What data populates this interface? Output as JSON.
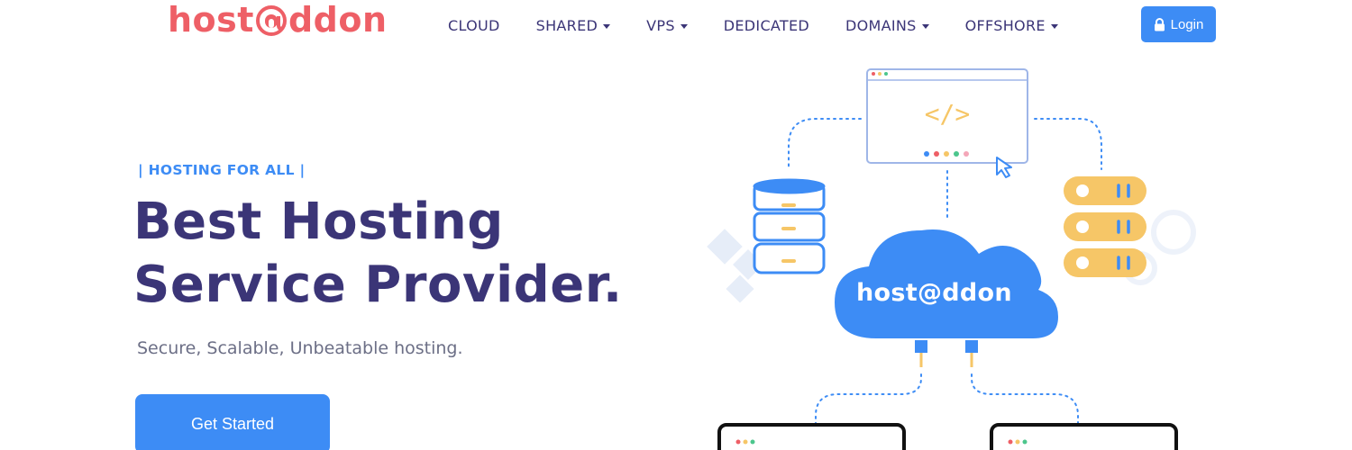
{
  "brand": {
    "name_before": "host",
    "name_after": "ddon",
    "color": "#ee5f66"
  },
  "nav": {
    "items": [
      {
        "label": "CLOUD",
        "dropdown": false
      },
      {
        "label": "SHARED",
        "dropdown": true
      },
      {
        "label": "VPS",
        "dropdown": true
      },
      {
        "label": "DEDICATED",
        "dropdown": false
      },
      {
        "label": "DOMAINS",
        "dropdown": true
      },
      {
        "label": "OFFSHORE",
        "dropdown": true
      }
    ],
    "login_label": "Login",
    "login_icon": "lock-icon"
  },
  "hero": {
    "eyebrow": "| HOSTING FOR ALL |",
    "headline_line1": "Best Hosting",
    "headline_line2": "Service Provider.",
    "subtext": "Secure, Scalable, Unbeatable hosting.",
    "cta_label": "Get Started"
  },
  "illustration": {
    "cloud_label": "host@ddon",
    "code_glyph": "</>",
    "accent_blue": "#3d8cf5",
    "accent_yellow": "#f6c667"
  },
  "colors": {
    "primary": "#3d8cf5",
    "heading": "#3b3577",
    "muted": "#6c6f86"
  }
}
